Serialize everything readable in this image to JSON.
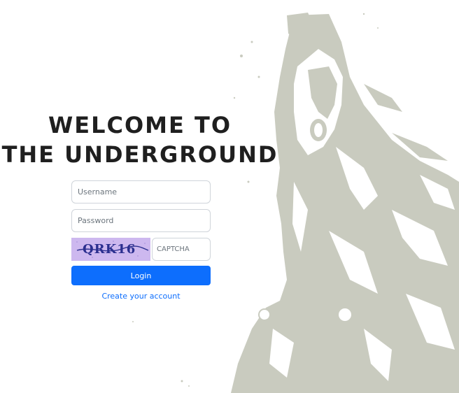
{
  "heading": {
    "line1": "WELCOME TO",
    "line2": "THE UNDERGROUND"
  },
  "form": {
    "username_placeholder": "Username",
    "password_placeholder": "Password",
    "captcha_code": "QRK16",
    "captcha_placeholder": "CAPTCHA",
    "login_label": "Login",
    "create_account_label": "Create your account"
  },
  "colors": {
    "accent": "#0d6efd",
    "art": "#c9cbbf",
    "captcha_bg": "#cdb8ef",
    "captcha_text": "#2b2f8f"
  },
  "icons": {
    "background": "hooded-figure-illustration"
  }
}
